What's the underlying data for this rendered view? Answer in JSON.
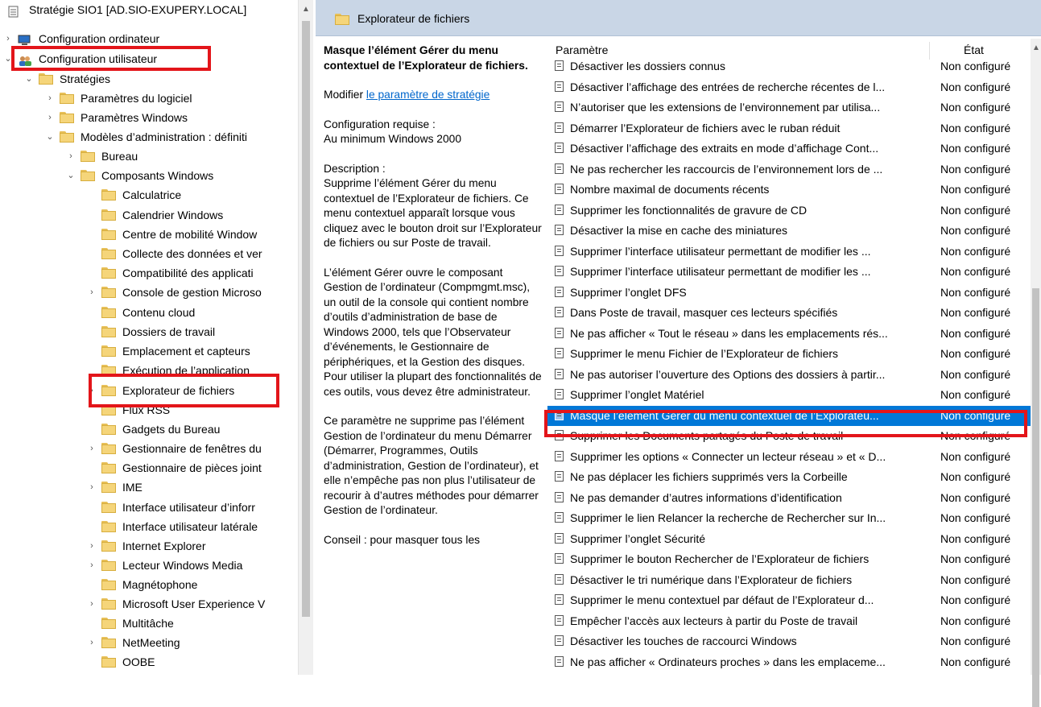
{
  "tree": {
    "rows": [
      {
        "label": "Stratégie SIO1 [AD.SIO-EXUPERY.LOCAL]",
        "expander": "",
        "icon": "policy-icon"
      },
      {
        "label": "Configuration ordinateur",
        "expander": "›",
        "icon": "computer-icon"
      },
      {
        "label": "Configuration utilisateur",
        "expander": "⌄",
        "icon": "users-icon"
      },
      {
        "label": "Stratégies",
        "expander": "⌄",
        "icon": "folder-icon"
      },
      {
        "label": "Paramètres du logiciel",
        "expander": "›",
        "icon": "folder-icon"
      },
      {
        "label": "Paramètres Windows",
        "expander": "›",
        "icon": "folder-icon"
      },
      {
        "label": "Modèles d’administration : définiti",
        "expander": "⌄",
        "icon": "folder-icon"
      },
      {
        "label": "Bureau",
        "expander": "›",
        "icon": "folder-icon"
      },
      {
        "label": "Composants Windows",
        "expander": "⌄",
        "icon": "folder-icon"
      },
      {
        "label": "Calculatrice",
        "expander": "",
        "icon": "folder-icon"
      },
      {
        "label": "Calendrier Windows",
        "expander": "",
        "icon": "folder-icon"
      },
      {
        "label": "Centre de mobilité Window",
        "expander": "",
        "icon": "folder-icon"
      },
      {
        "label": "Collecte des données et ver",
        "expander": "",
        "icon": "folder-icon"
      },
      {
        "label": "Compatibilité des applicati",
        "expander": "",
        "icon": "folder-icon"
      },
      {
        "label": "Console de gestion Microso",
        "expander": "›",
        "icon": "folder-icon"
      },
      {
        "label": "Contenu cloud",
        "expander": "",
        "icon": "folder-icon"
      },
      {
        "label": "Dossiers de travail",
        "expander": "",
        "icon": "folder-icon"
      },
      {
        "label": "Emplacement et capteurs",
        "expander": "",
        "icon": "folder-icon"
      },
      {
        "label": "Exécution de l’application",
        "expander": "",
        "icon": "folder-icon"
      },
      {
        "label": "Explorateur de fichiers",
        "expander": "›",
        "icon": "folder-icon"
      },
      {
        "label": "Flux RSS",
        "expander": "",
        "icon": "folder-icon"
      },
      {
        "label": "Gadgets du Bureau",
        "expander": "",
        "icon": "folder-icon"
      },
      {
        "label": "Gestionnaire de fenêtres du",
        "expander": "›",
        "icon": "folder-icon"
      },
      {
        "label": "Gestionnaire de pièces joint",
        "expander": "",
        "icon": "folder-icon"
      },
      {
        "label": "IME",
        "expander": "›",
        "icon": "folder-icon"
      },
      {
        "label": "Interface utilisateur d’inforr",
        "expander": "",
        "icon": "folder-icon"
      },
      {
        "label": "Interface utilisateur latérale",
        "expander": "",
        "icon": "folder-icon"
      },
      {
        "label": "Internet Explorer",
        "expander": "›",
        "icon": "folder-icon"
      },
      {
        "label": "Lecteur Windows Media",
        "expander": "›",
        "icon": "folder-icon"
      },
      {
        "label": "Magnétophone",
        "expander": "",
        "icon": "folder-icon"
      },
      {
        "label": "Microsoft User Experience V",
        "expander": "›",
        "icon": "folder-icon"
      },
      {
        "label": "Multitâche",
        "expander": "",
        "icon": "folder-icon"
      },
      {
        "label": "NetMeeting",
        "expander": "›",
        "icon": "folder-icon"
      },
      {
        "label": "OOBE",
        "expander": "",
        "icon": "folder-icon"
      }
    ]
  },
  "header": {
    "title": "Explorateur de fichiers"
  },
  "description": {
    "heading": "Masque l’élément Gérer du menu contextuel de l’Explorateur de fichiers.",
    "edit_prefix": "Modifier ",
    "edit_link": "le paramètre de stratégie",
    "req_label": "Configuration requise :",
    "req_value": "Au minimum Windows 2000",
    "desc_label": "Description :",
    "para1": "Supprime l’élément Gérer du menu contextuel de l’Explorateur de fichiers. Ce menu contextuel apparaît lorsque vous cliquez avec le bouton droit sur l’Explorateur de fichiers ou sur Poste de travail.",
    "para2": "L’élément Gérer ouvre le composant Gestion de l’ordinateur (Compmgmt.msc), un outil de la console qui contient nombre d’outils d’administration de base de Windows 2000, tels que l’Observateur d’événements, le Gestionnaire de périphériques, et la Gestion des disques. Pour utiliser la plupart des fonctionnalités de ces outils, vous devez être administrateur.",
    "para3": "Ce paramètre ne supprime pas l’élément Gestion de l’ordinateur du menu Démarrer (Démarrer, Programmes, Outils d’administration, Gestion de l’ordinateur), et elle n’empêche pas non plus l’utilisateur de recourir à d’autres méthodes pour démarrer Gestion de l’ordinateur.",
    "para4": "Conseil : pour masquer tous les"
  },
  "list": {
    "col_param": "Paramètre",
    "col_state": "État",
    "rows": [
      {
        "name": "Désactiver les dossiers connus",
        "state": "Non configuré"
      },
      {
        "name": "Désactiver l’affichage des entrées de recherche récentes de l...",
        "state": "Non configuré"
      },
      {
        "name": "N’autoriser que les extensions de l’environnement par utilisa...",
        "state": "Non configuré"
      },
      {
        "name": "Démarrer l’Explorateur de fichiers avec le ruban réduit",
        "state": "Non configuré"
      },
      {
        "name": "Désactiver l’affichage des extraits en mode d’affichage Cont...",
        "state": "Non configuré"
      },
      {
        "name": "Ne pas rechercher les raccourcis de l’environnement lors de ...",
        "state": "Non configuré"
      },
      {
        "name": "Nombre maximal de documents récents",
        "state": "Non configuré"
      },
      {
        "name": "Supprimer les fonctionnalités de gravure de CD",
        "state": "Non configuré"
      },
      {
        "name": "Désactiver la mise en cache des miniatures",
        "state": "Non configuré"
      },
      {
        "name": "Supprimer l’interface utilisateur permettant de modifier les ...",
        "state": "Non configuré"
      },
      {
        "name": "Supprimer l’interface utilisateur permettant de modifier les ...",
        "state": "Non configuré"
      },
      {
        "name": "Supprimer l’onglet DFS",
        "state": "Non configuré"
      },
      {
        "name": "Dans Poste de travail, masquer ces lecteurs spécifiés",
        "state": "Non configuré"
      },
      {
        "name": "Ne pas afficher « Tout le réseau » dans les emplacements rés...",
        "state": "Non configuré"
      },
      {
        "name": "Supprimer le menu Fichier de l’Explorateur de fichiers",
        "state": "Non configuré"
      },
      {
        "name": "Ne pas autoriser l’ouverture des Options des dossiers à partir...",
        "state": "Non configuré"
      },
      {
        "name": "Supprimer l’onglet Matériel",
        "state": "Non configuré"
      },
      {
        "name": "Masque l’élément Gérer du menu contextuel de l’Explorateu...",
        "state": "Non configuré"
      },
      {
        "name": "Supprimer les Documents partagés du Poste de travail",
        "state": "Non configuré"
      },
      {
        "name": "Supprimer les options « Connecter un lecteur réseau » et « D...",
        "state": "Non configuré"
      },
      {
        "name": "Ne pas déplacer les fichiers supprimés vers la Corbeille",
        "state": "Non configuré"
      },
      {
        "name": "Ne pas demander d’autres informations d’identification",
        "state": "Non configuré"
      },
      {
        "name": "Supprimer le lien Relancer la recherche de Rechercher sur In...",
        "state": "Non configuré"
      },
      {
        "name": "Supprimer l’onglet Sécurité",
        "state": "Non configuré"
      },
      {
        "name": "Supprimer le bouton Rechercher de l’Explorateur de fichiers",
        "state": "Non configuré"
      },
      {
        "name": "Désactiver le tri numérique dans l’Explorateur de fichiers",
        "state": "Non configuré"
      },
      {
        "name": "Supprimer le menu contextuel par défaut de l’Explorateur d...",
        "state": "Non configuré"
      },
      {
        "name": "Empêcher l’accès aux lecteurs à partir du Poste de travail",
        "state": "Non configuré"
      },
      {
        "name": "Désactiver les touches de raccourci Windows",
        "state": "Non configuré"
      },
      {
        "name": "Ne pas afficher « Ordinateurs proches » dans les emplaceme...",
        "state": "Non configuré"
      }
    ]
  },
  "colors": {
    "header_bg": "#c9d6e6",
    "selection": "#0078d7",
    "highlight": "#e3151a",
    "link": "#0066cc"
  }
}
